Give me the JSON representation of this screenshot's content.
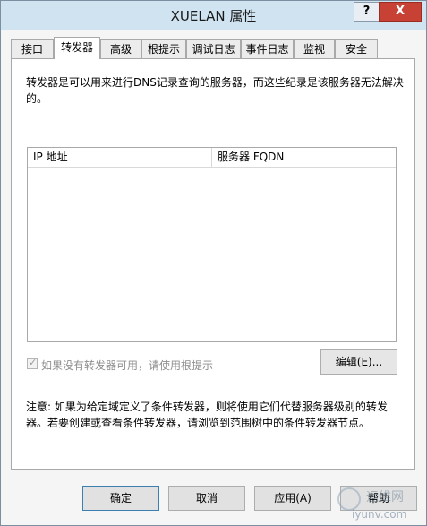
{
  "window": {
    "title": "XUELAN 属性",
    "help_label": "?",
    "close_label": "X"
  },
  "tabs": [
    {
      "label": "接口"
    },
    {
      "label": "转发器"
    },
    {
      "label": "高级"
    },
    {
      "label": "根提示"
    },
    {
      "label": "调试日志"
    },
    {
      "label": "事件日志"
    },
    {
      "label": "监视"
    },
    {
      "label": "安全"
    }
  ],
  "active_tab": "转发器",
  "forwarders": {
    "description": "转发器是可以用来进行DNS记录查询的服务器，而这些纪录是该服务器无法解决的。",
    "columns": [
      {
        "label": "IP 地址"
      },
      {
        "label": "服务器 FQDN"
      }
    ],
    "rows": [],
    "use_root_hints_label": "如果没有转发器可用，请使用根提示",
    "use_root_hints_checked": true,
    "use_root_hints_enabled": false,
    "edit_label": "编辑(E)...",
    "note": "注意: 如果为给定域定义了条件转发器，则将使用它们代替服务器级别的转发器。若要创建或查看条件转发器，请浏览到范围树中的条件转发器节点。"
  },
  "footer": {
    "ok_label": "确定",
    "cancel_label": "取消",
    "apply_label": "应用(A)",
    "help_label": "帮助"
  },
  "watermark": {
    "top": "运维网",
    "bottom": "iyunv.com"
  }
}
